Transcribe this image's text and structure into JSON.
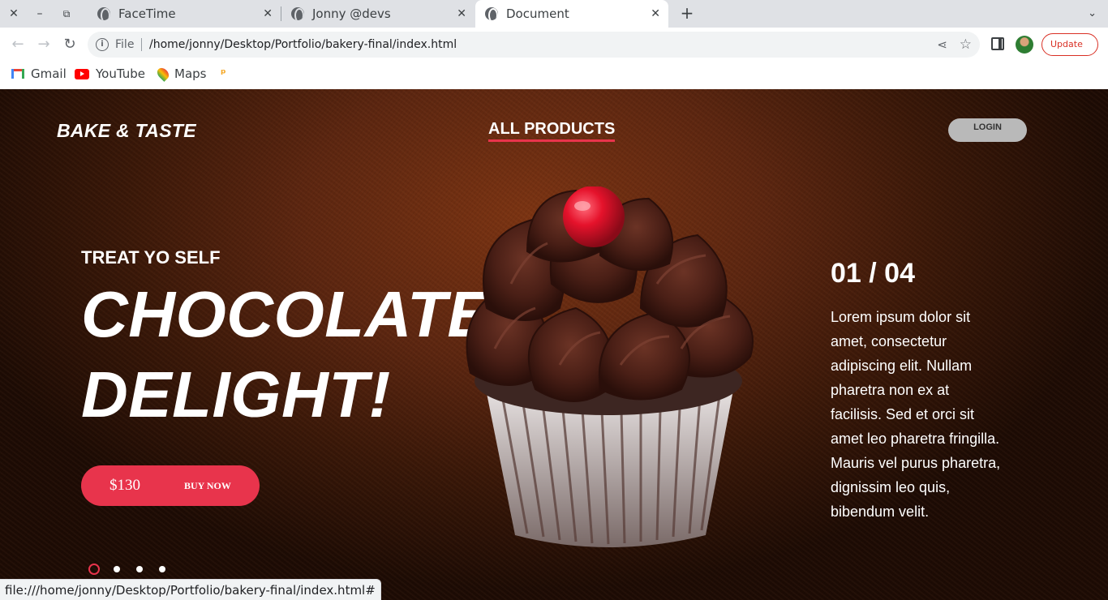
{
  "browser": {
    "tabs": [
      {
        "title": "FaceTime"
      },
      {
        "title": "Jonny @devs"
      },
      {
        "title": "Document"
      }
    ],
    "address": {
      "scheme_label": "File",
      "url": "/home/jonny/Desktop/Portfolio/bakery-final/index.html"
    },
    "update_label": "Update",
    "bookmarks": [
      {
        "label": "Gmail"
      },
      {
        "label": "YouTube"
      },
      {
        "label": "Maps"
      }
    ],
    "status_url": "file:///home/jonny/Desktop/Portfolio/bakery-final/index.html#"
  },
  "site": {
    "brand": "BAKE & TASTE",
    "nav_link": "ALL PRODUCTS",
    "login_label": "LOGIN",
    "subtitle": "TREAT YO SELF",
    "headline_line1": "CHOCOLATE",
    "headline_line2": "DELIGHT!",
    "price": "$130",
    "buy_label": "BUY NOW",
    "slide_counter": "01 / 04",
    "description": "Lorem ipsum dolor sit amet, consectetur adipiscing elit. Nullam pharetra non ex at facilisis. Sed et orci sit amet leo pharetra fringilla. Mauris vel purus pharetra, dignissim leo quis, bibendum velit.",
    "slides_total": 4,
    "active_slide": 1
  },
  "colors": {
    "accent": "#e8344c",
    "background_brown": "#5a2510",
    "login_bg": "#b9b9b9"
  }
}
